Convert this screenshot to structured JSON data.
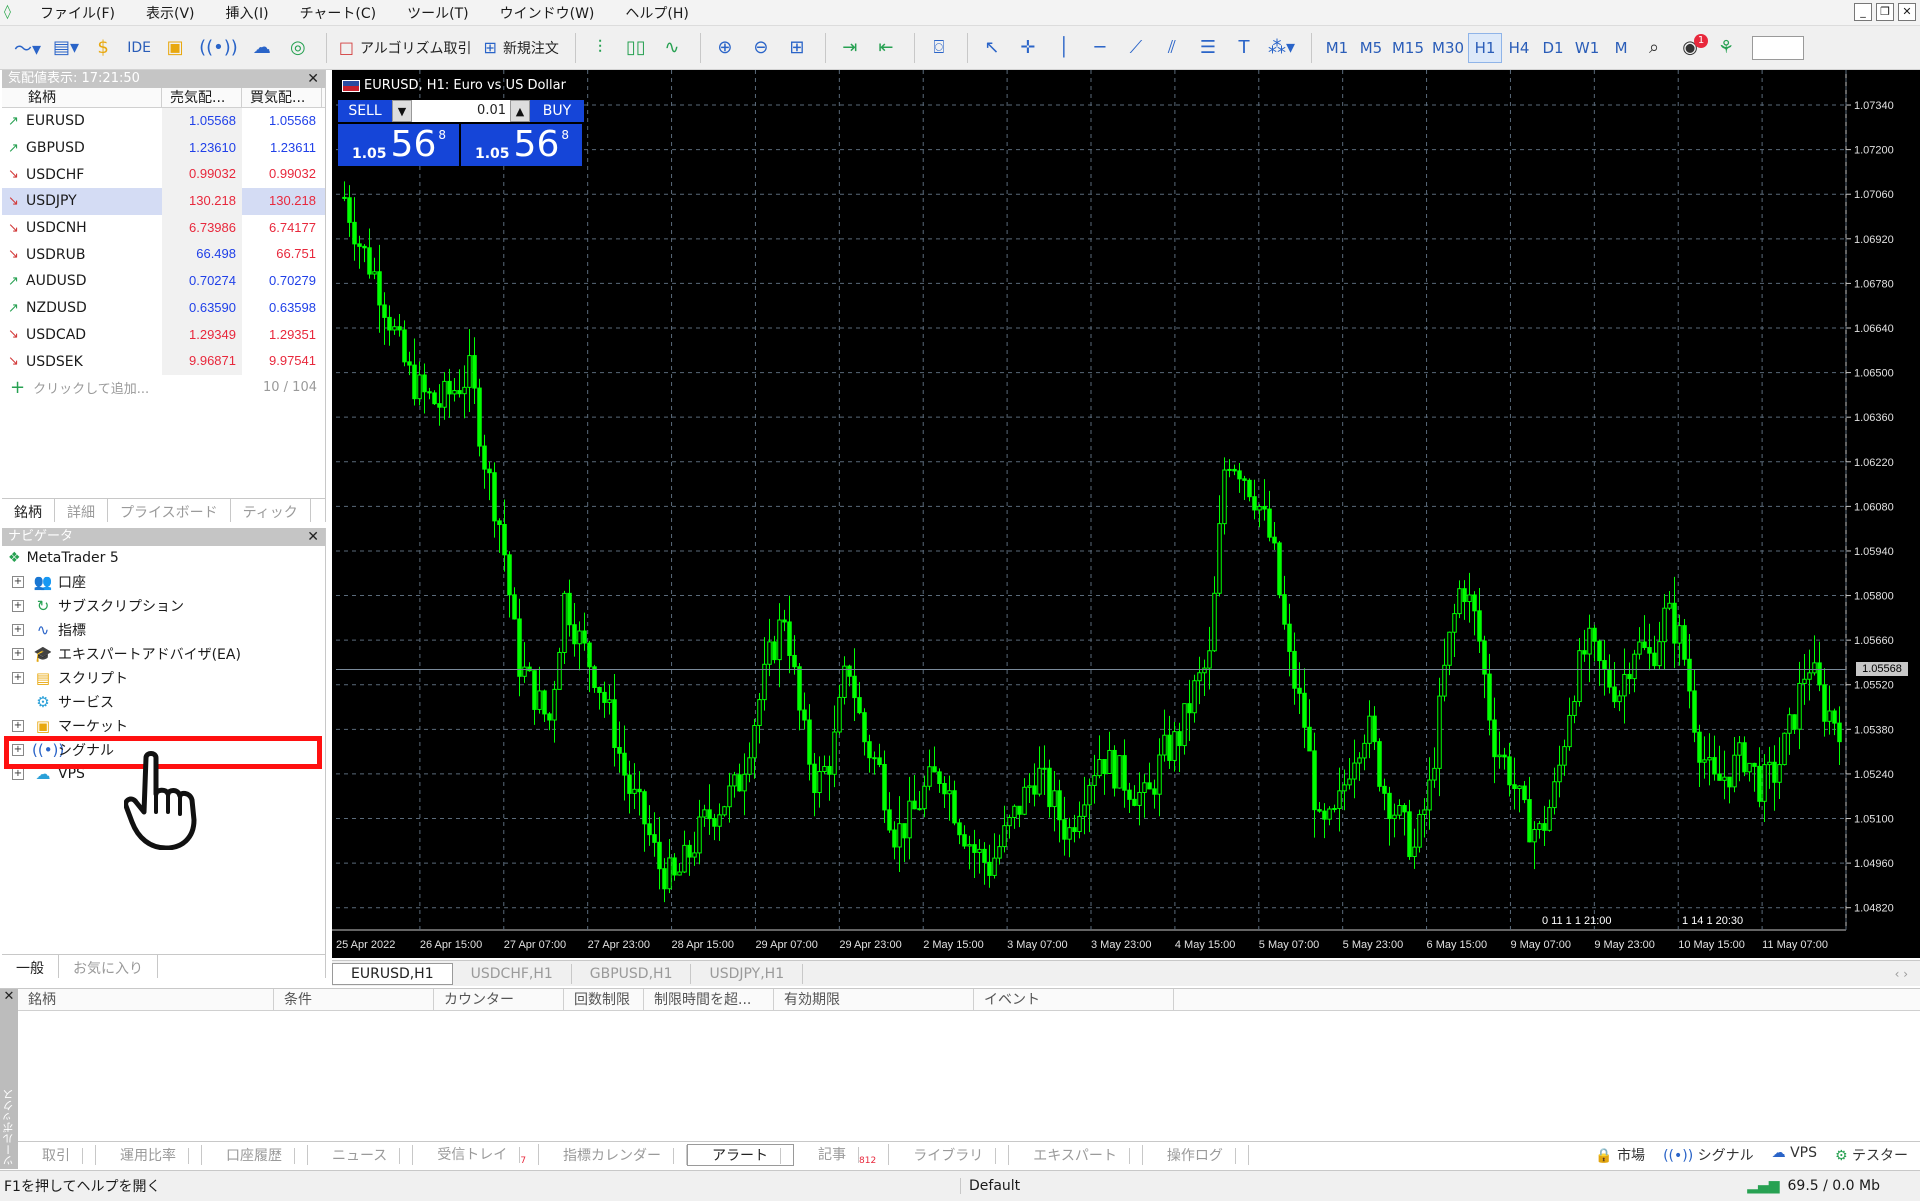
{
  "menu": {
    "app_icon": "mt5-logo-icon",
    "items": [
      "ファイル(F)",
      "表示(V)",
      "挿入(I)",
      "チャート(C)",
      "ツール(T)",
      "ウインドウ(W)",
      "ヘルプ(H)"
    ]
  },
  "toolbar": {
    "ide_label": "IDE",
    "algo_label": "アルゴリズム取引",
    "new_order_label": "新規注文",
    "timeframes": [
      "M1",
      "M5",
      "M15",
      "M30",
      "H1",
      "H4",
      "D1",
      "W1",
      "M"
    ],
    "active_timeframe": "H1",
    "notification_count": "1"
  },
  "market_watch": {
    "title": "気配値表示: 17:21:50",
    "col_symbol": "銘柄",
    "col_bid": "売気配...",
    "col_ask": "買気配...",
    "rows": [
      {
        "symbol": "EURUSD",
        "dir": "up",
        "bid": "1.05568",
        "ask": "1.05568",
        "color": "blue"
      },
      {
        "symbol": "GBPUSD",
        "dir": "up",
        "bid": "1.23610",
        "ask": "1.23611",
        "color": "blue"
      },
      {
        "symbol": "USDCHF",
        "dir": "down",
        "bid": "0.99032",
        "ask": "0.99032",
        "color": "red"
      },
      {
        "symbol": "USDJPY",
        "dir": "down",
        "bid": "130.218",
        "ask": "130.218",
        "color": "red"
      },
      {
        "symbol": "USDCNH",
        "dir": "down",
        "bid": "6.73986",
        "ask": "6.74177",
        "color": "red"
      },
      {
        "symbol": "USDRUB",
        "dir": "down",
        "bid": "66.498",
        "ask": "66.751",
        "color": "mixed"
      },
      {
        "symbol": "AUDUSD",
        "dir": "up",
        "bid": "0.70274",
        "ask": "0.70279",
        "color": "blue"
      },
      {
        "symbol": "NZDUSD",
        "dir": "up",
        "bid": "0.63590",
        "ask": "0.63598",
        "color": "blue"
      },
      {
        "symbol": "USDCAD",
        "dir": "down",
        "bid": "1.29349",
        "ask": "1.29351",
        "color": "red"
      },
      {
        "symbol": "USDSEK",
        "dir": "down",
        "bid": "9.96871",
        "ask": "9.97541",
        "color": "red"
      }
    ],
    "add_label": "クリックして追加...",
    "count": "10 / 104",
    "tabs": [
      "銘柄",
      "詳細",
      "プライスボード",
      "ティック"
    ]
  },
  "navigator": {
    "title": "ナビゲータ",
    "root": "MetaTrader 5",
    "items": [
      {
        "label": "口座",
        "icon": "accounts-icon"
      },
      {
        "label": "サブスクリプション",
        "icon": "subscription-icon"
      },
      {
        "label": "指標",
        "icon": "indicators-icon"
      },
      {
        "label": "エキスパートアドバイザ(EA)",
        "icon": "expert-advisor-icon"
      },
      {
        "label": "スクリプト",
        "icon": "scripts-icon"
      },
      {
        "label": "サービス",
        "icon": "services-icon"
      },
      {
        "label": "マーケット",
        "icon": "market-icon"
      },
      {
        "label": "シグナル",
        "icon": "signals-icon"
      },
      {
        "label": "VPS",
        "icon": "vps-icon"
      }
    ],
    "tabs": [
      "一般",
      "お気に入り"
    ]
  },
  "chart": {
    "title": "EURUSD, H1:  Euro vs US Dollar",
    "sell_label": "SELL",
    "buy_label": "BUY",
    "volume": "0.01",
    "sell_price_prefix": "1.05",
    "sell_price_big": "56",
    "sell_price_sup": "8",
    "buy_price_prefix": "1.05",
    "buy_price_big": "56",
    "buy_price_sup": "8",
    "current_price": "1.05568",
    "scroll_label_1": "0 11 1 1 21:00",
    "scroll_label_2": "1 14 1 20:30"
  },
  "chart_data": {
    "type": "candlestick",
    "symbol": "EURUSD",
    "timeframe": "H1",
    "y_ticks": [
      "1.07340",
      "1.07200",
      "1.07060",
      "1.06920",
      "1.06780",
      "1.06640",
      "1.06500",
      "1.06360",
      "1.06220",
      "1.06080",
      "1.05940",
      "1.05800",
      "1.05660",
      "1.05520",
      "1.05380",
      "1.05240",
      "1.05100",
      "1.04960",
      "1.04820"
    ],
    "ylim": [
      1.0475,
      1.0745
    ],
    "x_ticks": [
      "25 Apr 2022",
      "26 Apr 15:00",
      "27 Apr 07:00",
      "27 Apr 23:00",
      "28 Apr 15:00",
      "29 Apr 07:00",
      "29 Apr 23:00",
      "2 May 15:00",
      "3 May 07:00",
      "3 May 23:00",
      "4 May 15:00",
      "5 May 07:00",
      "5 May 23:00",
      "6 May 15:00",
      "9 May 07:00",
      "9 May 23:00",
      "10 May 15:00",
      "11 May 07:00"
    ],
    "current_price": 1.05568,
    "close_path": [
      1.0705,
      1.069,
      1.068,
      1.0665,
      1.065,
      1.0643,
      1.064,
      1.0645,
      1.065,
      1.062,
      1.06,
      1.056,
      1.055,
      1.054,
      1.058,
      1.0565,
      1.0555,
      1.054,
      1.052,
      1.051,
      1.0495,
      1.049,
      1.05,
      1.051,
      1.0515,
      1.052,
      1.054,
      1.056,
      1.0575,
      1.054,
      1.052,
      1.053,
      1.056,
      1.0535,
      1.0525,
      1.0505,
      1.051,
      1.052,
      1.0525,
      1.051,
      1.05,
      1.0495,
      1.0505,
      1.0515,
      1.0525,
      1.0515,
      1.0505,
      1.052,
      1.053,
      1.0525,
      1.052,
      1.0515,
      1.053,
      1.0535,
      1.055,
      1.056,
      1.0625,
      1.062,
      1.061,
      1.0595,
      1.056,
      1.054,
      1.0505,
      1.051,
      1.053,
      1.054,
      1.052,
      1.051,
      1.05,
      1.052,
      1.056,
      1.0585,
      1.057,
      1.0535,
      1.0525,
      1.051,
      1.0505,
      1.052,
      1.055,
      1.0565,
      1.0555,
      1.055,
      1.0565,
      1.056,
      1.0575,
      1.0565,
      1.0535,
      1.052,
      1.0525,
      1.053,
      1.052,
      1.0525,
      1.054,
      1.056,
      1.0545,
      1.054
    ]
  },
  "chart_tabs": [
    "EURUSD,H1",
    "USDCHF,H1",
    "GBPUSD,H1",
    "USDJPY,H1"
  ],
  "toolbox": {
    "side_label": "ツールボックス",
    "columns": [
      "銘柄",
      "条件",
      "カウンター",
      "回数制限",
      "制限時間を超...",
      "有効期限",
      "イベント"
    ],
    "tabs": [
      "取引",
      "運用比率",
      "口座履歴",
      "ニュース",
      "受信トレイ",
      "指標カレンダー",
      "アラート",
      "記事",
      "ライブラリ",
      "エキスパート",
      "操作ログ"
    ],
    "inbox_badge": "7",
    "articles_badge": "812",
    "active_tab": "アラート",
    "right_links": [
      "市場",
      "シグナル",
      "VPS",
      "テスター"
    ]
  },
  "status": {
    "help_text": "F1を押してヘルプを開く",
    "profile": "Default",
    "traffic": "69.5 / 0.0 Mb"
  },
  "colors": {
    "chart_bg": "#000000",
    "candle": "#00ff00",
    "grid": "#5a6a7a",
    "price_line": "#7a8a9a",
    "highlight_box": "#ff1010",
    "one_click_blue": "#1545d8"
  }
}
